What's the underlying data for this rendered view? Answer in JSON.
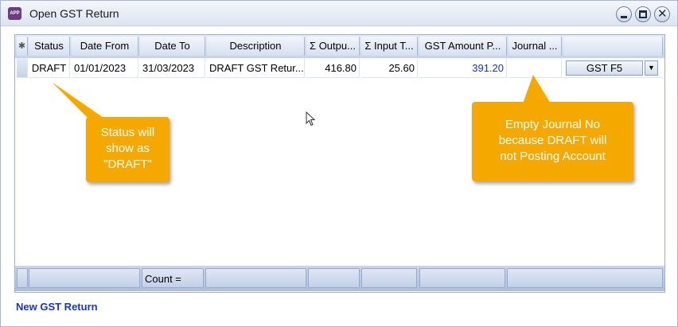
{
  "window": {
    "title": "Open GST Return",
    "icon_label": "APP"
  },
  "grid": {
    "columns": [
      "Status",
      "Date From",
      "Date To",
      "Description",
      "Σ Outpu...",
      "Σ Input T...",
      "GST Amount P...",
      "Journal ..."
    ],
    "row": {
      "status": "DRAFT",
      "date_from": "01/01/2023",
      "date_to": "31/03/2023",
      "description": "DRAFT GST Retur...",
      "output_tax": "416.80",
      "input_tax": "25.60",
      "gst_amount": "391.20",
      "journal_no": "",
      "form_type": "GST F5"
    },
    "footer": {
      "count_label": "Count ="
    }
  },
  "actions": {
    "new_return": "New GST Return"
  },
  "callouts": {
    "status_note": [
      "Status will",
      "show as",
      "\"DRAFT\""
    ],
    "journal_note": [
      "Empty Journal No",
      "because DRAFT will",
      "not Posting Account"
    ]
  },
  "colors": {
    "callout": "#f5a900",
    "link": "#1a33c8",
    "header_gradient": "#c5d3ea"
  },
  "icons": {
    "app": "app-icon",
    "minimize": "minimize-icon",
    "maximize": "maximize-icon",
    "close": "close-icon",
    "dropdown": "chevron-down-icon",
    "cursor": "mouse-cursor-icon"
  }
}
